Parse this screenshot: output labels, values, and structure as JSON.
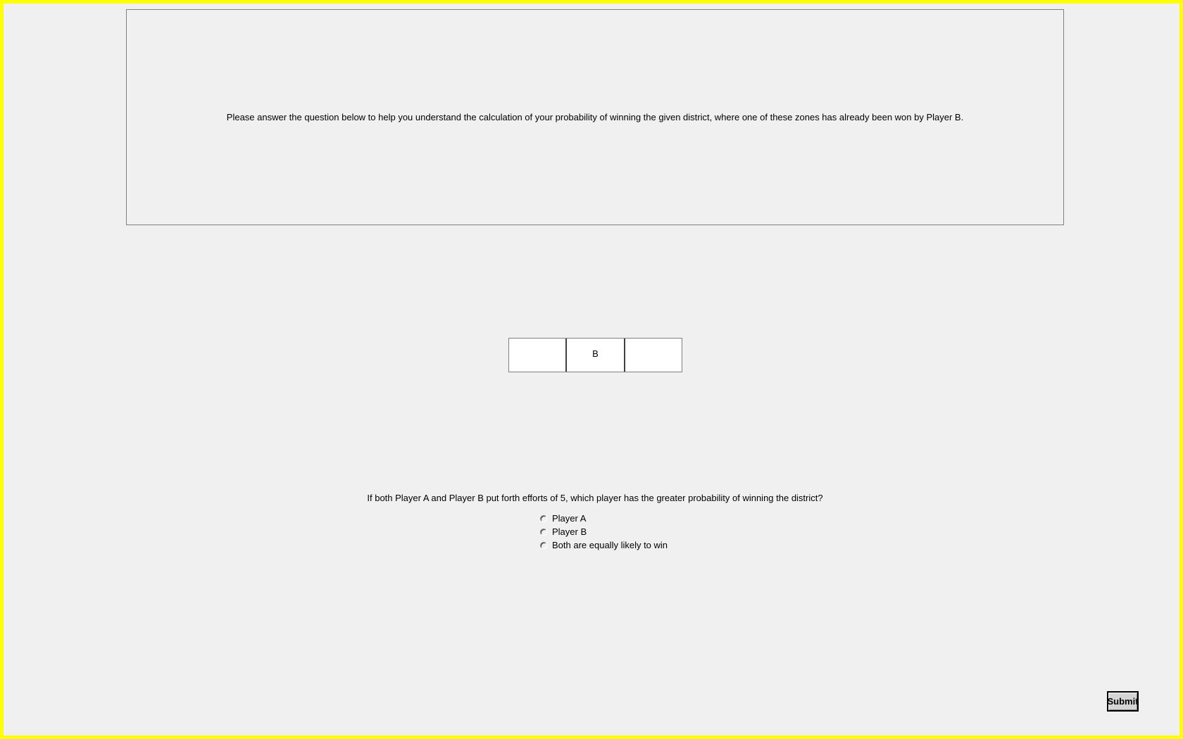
{
  "instruction": "Please answer the question below to help you understand the calculation of your probability of winning the given district, where one of these zones has already been won by Player B.",
  "zones": [
    "",
    "B",
    ""
  ],
  "question": {
    "text": "If both Player A and Player B put forth efforts of 5, which player has the greater probability of winning the district?",
    "options": [
      "Player A",
      "Player B",
      "Both are equally likely to win"
    ]
  },
  "submit_label": "Submit",
  "colors": {
    "frame_border": "#ffff00",
    "background": "#f0f0f0"
  }
}
